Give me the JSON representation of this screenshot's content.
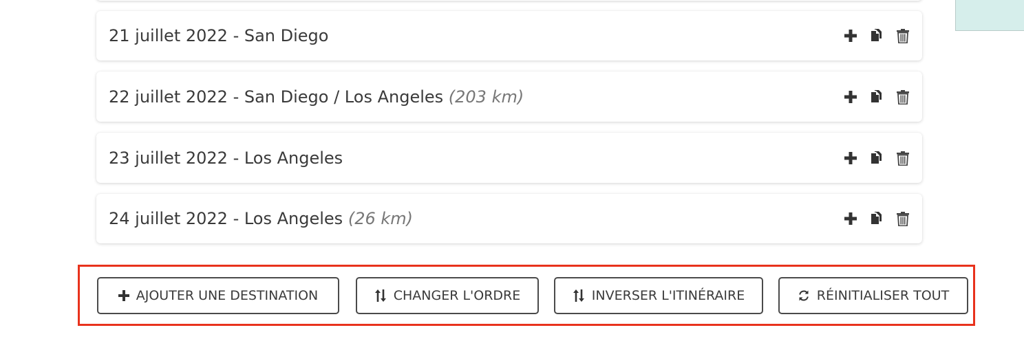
{
  "days": [
    {
      "date_label": "21 juillet 2022 - San Diego",
      "distance": ""
    },
    {
      "date_label": "22 juillet 2022 - San Diego / Los Angeles",
      "distance": "(203 km)"
    },
    {
      "date_label": "23 juillet 2022 - Los Angeles",
      "distance": ""
    },
    {
      "date_label": "24 juillet 2022 - Los Angeles",
      "distance": "(26 km)"
    }
  ],
  "day_actions": [
    "plus-icon",
    "copy-icon",
    "trash-icon"
  ],
  "actions": {
    "add_destination": {
      "label": "AJOUTER UNE DESTINATION",
      "icon": "plus-icon"
    },
    "change_order": {
      "label": "CHANGER L'ORDRE",
      "icon": "sort-arrows-icon"
    },
    "reverse_route": {
      "label": "INVERSER L'ITINÉRAIRE",
      "icon": "sort-arrows-icon"
    },
    "reset_all": {
      "label": "RÉINITIALISER TOUT",
      "icon": "refresh-icon"
    }
  },
  "colors": {
    "highlight_border": "#e8321c",
    "side_panel": "#d6eeeb",
    "text": "#3a3a3a",
    "distance_text": "#777777"
  }
}
